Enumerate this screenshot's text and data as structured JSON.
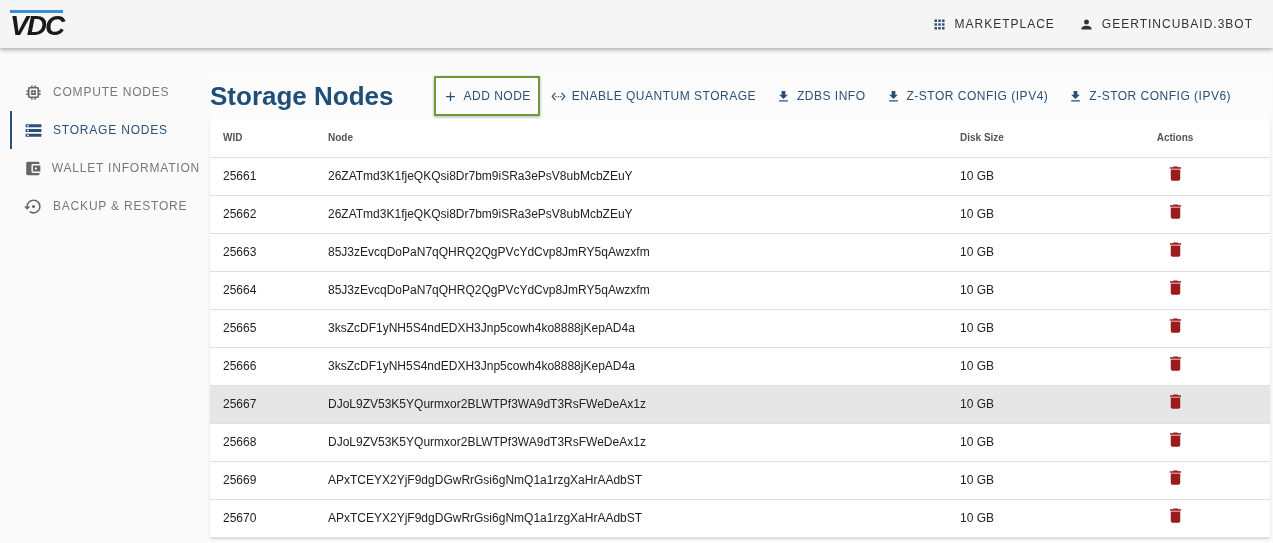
{
  "header": {
    "logo": "VDC",
    "links": [
      {
        "kind": "grid",
        "label": "MARKETPLACE"
      },
      {
        "kind": "user",
        "label": "GEERTINCUBAID.3BOT"
      }
    ]
  },
  "sidebar": {
    "items": [
      {
        "kind": "chip",
        "label": "COMPUTE NODES",
        "selected": false
      },
      {
        "kind": "server",
        "label": "STORAGE NODES",
        "selected": true
      },
      {
        "kind": "wallet",
        "label": "WALLET INFORMATION",
        "selected": false
      },
      {
        "kind": "restore",
        "label": "BACKUP & RESTORE",
        "selected": false
      }
    ]
  },
  "page": {
    "title": "Storage Nodes",
    "actions": [
      {
        "kind": "add",
        "label": "ADD NODE",
        "focused": true
      },
      {
        "kind": "quantum",
        "label": "ENABLE QUANTUM STORAGE",
        "focused": false
      },
      {
        "kind": "download",
        "label": "ZDBS INFO",
        "focused": false
      },
      {
        "kind": "download",
        "label": "Z-STOR CONFIG (IPV4)",
        "focused": false
      },
      {
        "kind": "download",
        "label": "Z-STOR CONFIG (IPV6)",
        "focused": false
      }
    ]
  },
  "table": {
    "columns": [
      "WID",
      "Node",
      "Disk Size",
      "Actions"
    ],
    "rows": [
      {
        "wid": "25661",
        "node": "26ZATmd3K1fjeQKQsi8Dr7bm9iSRa3ePsV8ubMcbZEuY",
        "disk_size": "10 GB",
        "highlighted": false
      },
      {
        "wid": "25662",
        "node": "26ZATmd3K1fjeQKQsi8Dr7bm9iSRa3ePsV8ubMcbZEuY",
        "disk_size": "10 GB",
        "highlighted": false
      },
      {
        "wid": "25663",
        "node": "85J3zEvcqDoPaN7qQHRQ2QgPVcYdCvp8JmRY5qAwzxfm",
        "disk_size": "10 GB",
        "highlighted": false
      },
      {
        "wid": "25664",
        "node": "85J3zEvcqDoPaN7qQHRQ2QgPVcYdCvp8JmRY5qAwzxfm",
        "disk_size": "10 GB",
        "highlighted": false
      },
      {
        "wid": "25665",
        "node": "3ksZcDF1yNH5S4ndEDXH3Jnp5cowh4ko8888jKepAD4a",
        "disk_size": "10 GB",
        "highlighted": false
      },
      {
        "wid": "25666",
        "node": "3ksZcDF1yNH5S4ndEDXH3Jnp5cowh4ko8888jKepAD4a",
        "disk_size": "10 GB",
        "highlighted": false
      },
      {
        "wid": "25667",
        "node": "DJoL9ZV53K5YQurmxor2BLWTPf3WA9dT3RsFWeDeAx1z",
        "disk_size": "10 GB",
        "highlighted": true
      },
      {
        "wid": "25668",
        "node": "DJoL9ZV53K5YQurmxor2BLWTPf3WA9dT3RsFWeDeAx1z",
        "disk_size": "10 GB",
        "highlighted": false
      },
      {
        "wid": "25669",
        "node": "APxTCEYX2YjF9dgDGwRrGsi6gNmQ1a1rzgXaHrAAdbST",
        "disk_size": "10 GB",
        "highlighted": false
      },
      {
        "wid": "25670",
        "node": "APxTCEYX2YjF9dgDGwRrGsi6gNmQ1a1rzgXaHrAAdbST",
        "disk_size": "10 GB",
        "highlighted": false
      }
    ]
  }
}
